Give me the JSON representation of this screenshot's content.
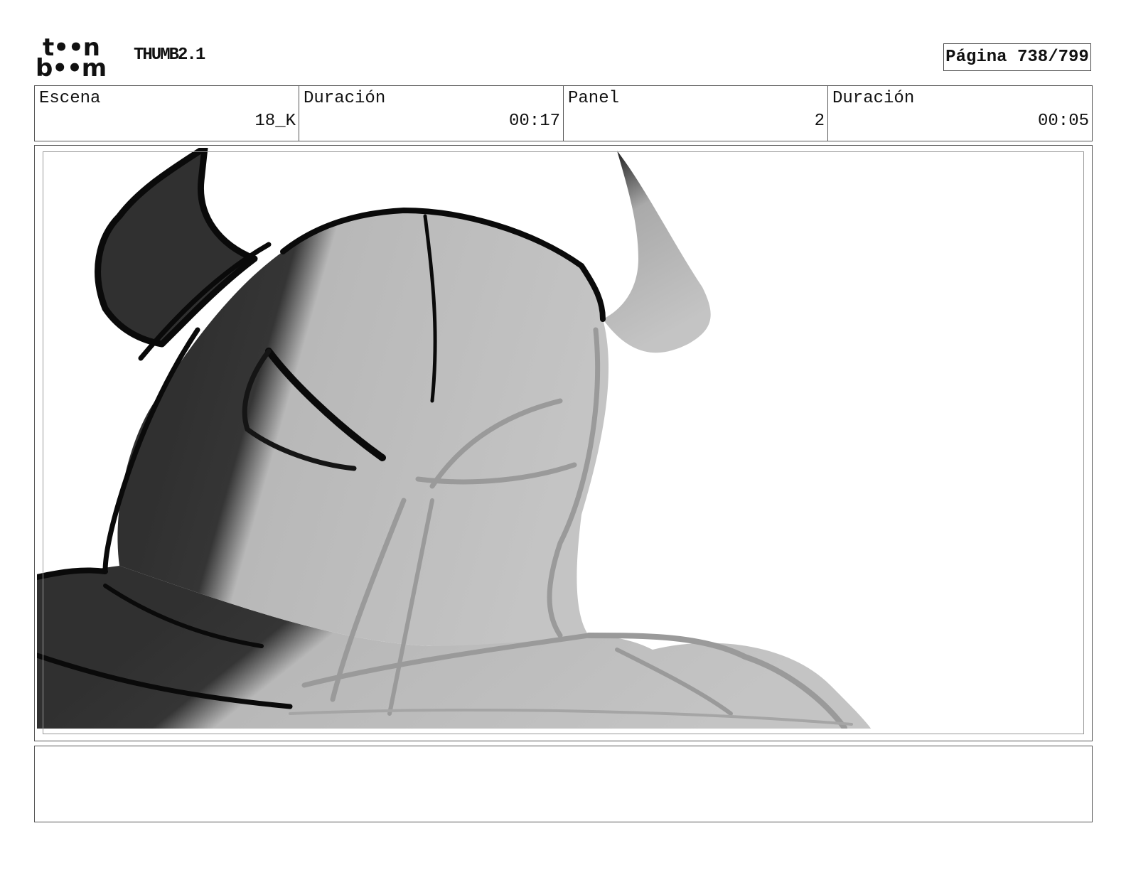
{
  "header": {
    "logo": {
      "line1": "t••n",
      "line2": "b••m"
    },
    "project": "THUMB2.1",
    "page": "Página 738/799"
  },
  "info": [
    {
      "label": "Escena",
      "value": "18_K"
    },
    {
      "label": "Duración",
      "value": "00:17"
    },
    {
      "label": "Panel",
      "value": "2"
    },
    {
      "label": "Duración",
      "value": "00:05"
    }
  ],
  "panel": {
    "subject": "horned-helmet-sketch-icon"
  },
  "notes": {
    "text": ""
  }
}
